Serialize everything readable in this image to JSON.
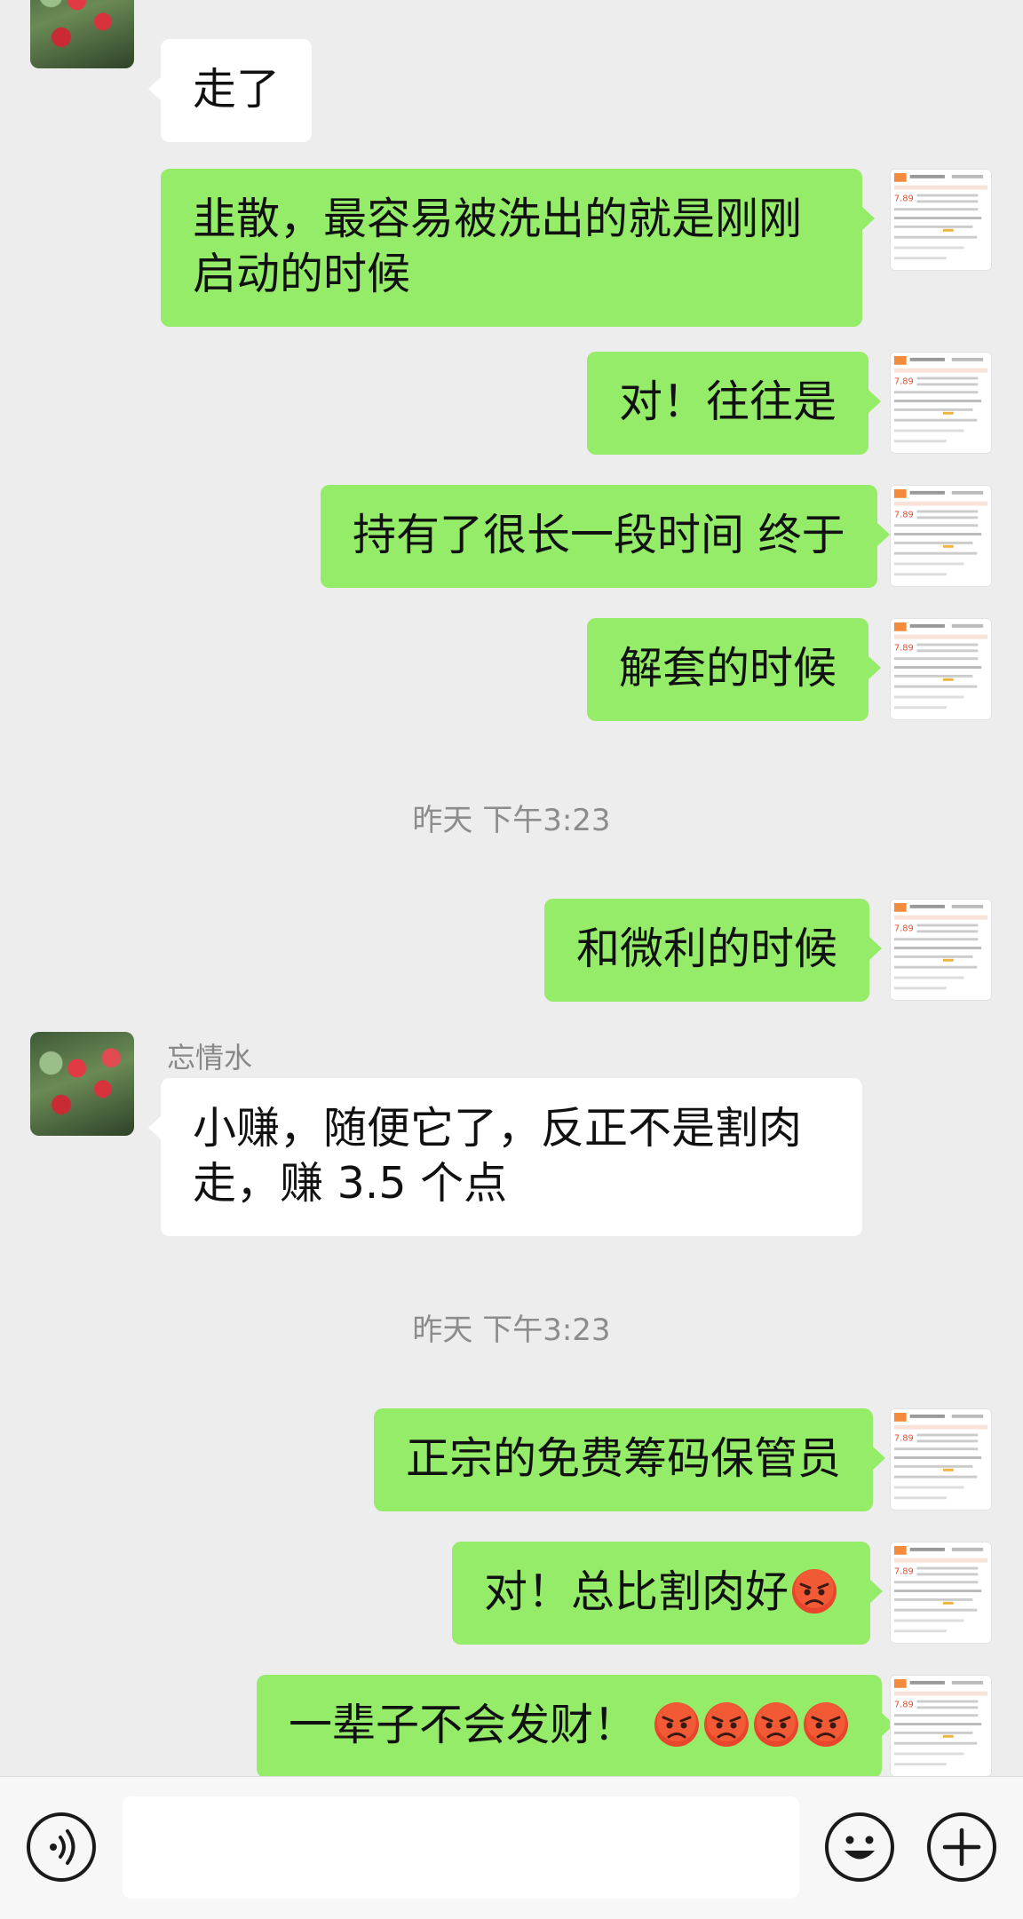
{
  "contact": {
    "name": "忘情水"
  },
  "messages": [
    {
      "dir": "in",
      "text": "走了"
    },
    {
      "dir": "out",
      "text": "韭散，最容易被洗出的就是刚刚启动的时候"
    },
    {
      "dir": "out",
      "text": "对！往往是"
    },
    {
      "dir": "out",
      "text": "持有了很长一段时间 终于"
    },
    {
      "dir": "out",
      "text": "解套的时候"
    },
    {
      "type": "timestamp",
      "text": "昨天 下午3:23"
    },
    {
      "dir": "out",
      "text": "和微利的时候"
    },
    {
      "dir": "in",
      "sender": "忘情水",
      "text": "小赚，随便它了，反正不是割肉走，赚 3.5 个点"
    },
    {
      "type": "timestamp",
      "text": "昨天 下午3:23"
    },
    {
      "dir": "out",
      "text": "正宗的免费筹码保管员"
    },
    {
      "dir": "out",
      "text": "对！总比割肉好",
      "emojis": [
        "angry-face"
      ]
    },
    {
      "dir": "out",
      "text": "一辈子不会发财！",
      "emojis": [
        "angry-face",
        "angry-face",
        "angry-face",
        "angry-face"
      ]
    }
  ],
  "input": {
    "value": "",
    "placeholder": ""
  },
  "icons": {
    "voice": "voice-mode-icon",
    "emoji": "emoji-icon",
    "plus": "plus-icon",
    "angry": "angry-face-emoji"
  },
  "colors": {
    "background": "#ededed",
    "outgoing_bubble": "#95ec69",
    "incoming_bubble": "#ffffff",
    "timestamp_text": "#8c8c8c"
  }
}
